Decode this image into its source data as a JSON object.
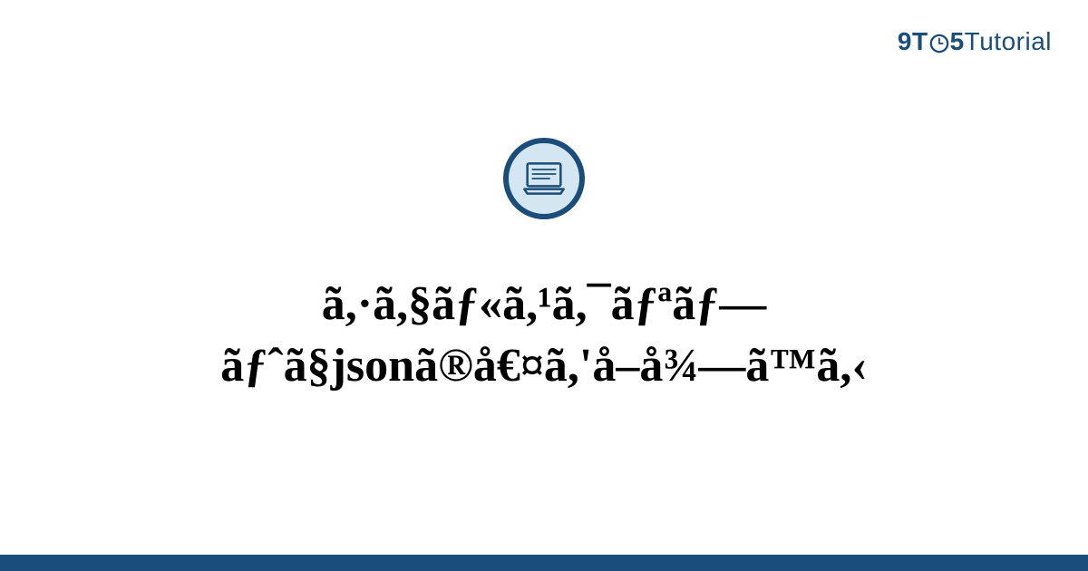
{
  "logo": {
    "nine": "9",
    "t1": "T",
    "five": "5",
    "tutorial": "Tutorial"
  },
  "title": {
    "line1": "ã,·ã,§ãƒ«ã,¹ã,¯ãƒªãƒ—",
    "line2": "ãƒˆã§jsonã®å€¤ã,'å–å¾—ã™ã,‹"
  },
  "colors": {
    "brand": "#1a4d7a",
    "iconBg": "#d4e6f1"
  }
}
